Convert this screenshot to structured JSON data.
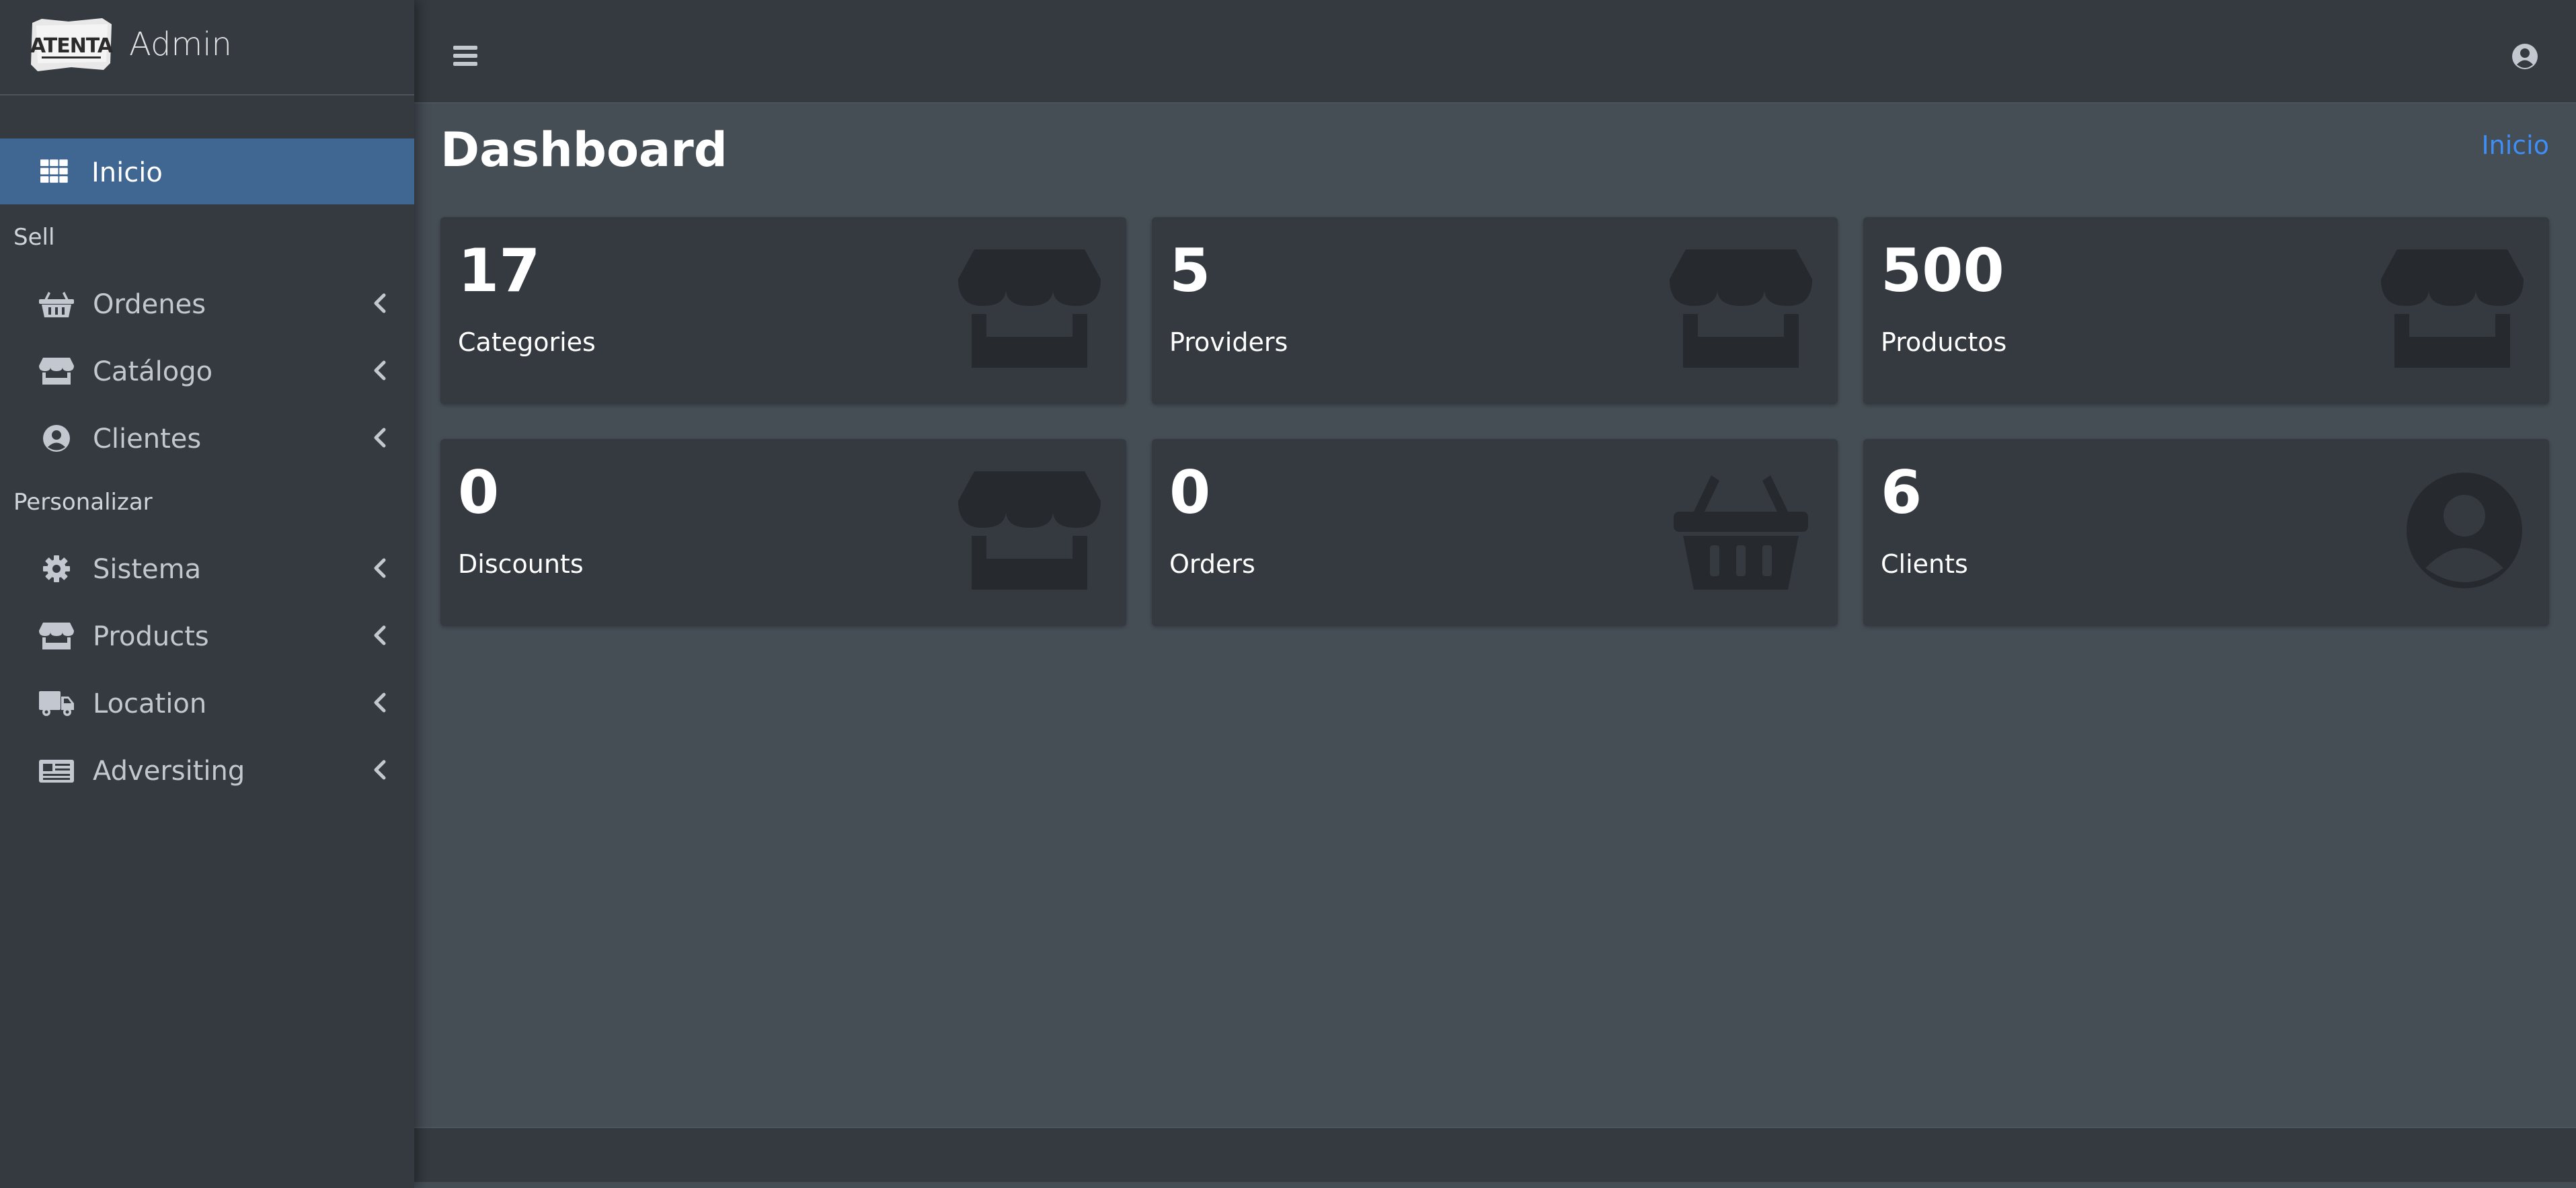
{
  "brand": {
    "logo_text": "ATENTA",
    "title": "Admin"
  },
  "sidebar": {
    "active": {
      "label": "Inicio",
      "icon": "grid-icon"
    },
    "sections": [
      {
        "header": "Sell"
      },
      {
        "header": "Personalizar"
      }
    ],
    "items": [
      {
        "label": "Ordenes",
        "icon": "basket-icon"
      },
      {
        "label": "Catálogo",
        "icon": "store-icon"
      },
      {
        "label": "Clientes",
        "icon": "user-circle-icon"
      },
      {
        "label": "Sistema",
        "icon": "gear-icon"
      },
      {
        "label": "Products",
        "icon": "store-icon"
      },
      {
        "label": "Location",
        "icon": "truck-icon"
      },
      {
        "label": "Adversiting",
        "icon": "newspaper-icon"
      }
    ]
  },
  "topbar": {
    "menu_icon": "hamburger-icon",
    "user_icon": "user-circle-icon"
  },
  "page": {
    "title": "Dashboard",
    "breadcrumb": "Inicio"
  },
  "cards": [
    {
      "value": "17",
      "label": "Categories",
      "icon": "store-icon"
    },
    {
      "value": "5",
      "label": "Providers",
      "icon": "store-icon"
    },
    {
      "value": "500",
      "label": "Productos",
      "icon": "store-icon"
    },
    {
      "value": "0",
      "label": "Discounts",
      "icon": "store-icon"
    },
    {
      "value": "0",
      "label": "Orders",
      "icon": "basket-icon"
    },
    {
      "value": "6",
      "label": "Clients",
      "icon": "user-circle-icon"
    }
  ],
  "colors": {
    "sidebar_bg": "#343a40",
    "content_bg": "#454d55",
    "active_bg": "#3f6791",
    "link": "#3f8ef5",
    "card_icon": "#26292d"
  }
}
